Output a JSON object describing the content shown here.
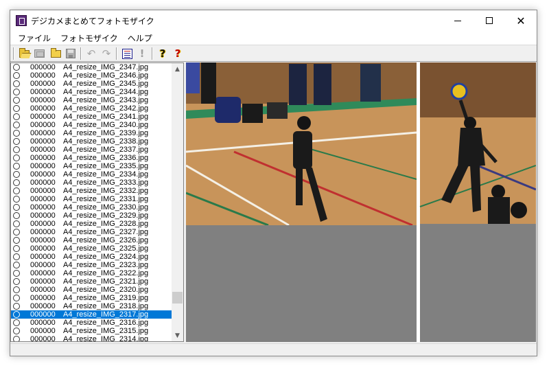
{
  "window": {
    "title": "デジカメまとめてフォトモザイク",
    "controls": {
      "minimize_icon": "minimize-icon",
      "maximize_icon": "maximize-icon",
      "close_glyph": "✕"
    }
  },
  "menu": {
    "items": [
      {
        "label": "ファイル"
      },
      {
        "label": "フォトモザイク"
      },
      {
        "label": "ヘルプ"
      }
    ]
  },
  "toolbar": {
    "icons": [
      "folder-open-icon",
      "image-gray-icon",
      "folder-icon",
      "save-icon",
      "undo-icon",
      "redo-icon",
      "list-icon",
      "exclamation-icon",
      "help-icon",
      "help-red-icon"
    ],
    "undo_glyph": "↶",
    "redo_glyph": "↷",
    "exclaim_glyph": "!",
    "help_glyph": "?",
    "help_red_glyph": "?"
  },
  "file_list": {
    "selected_index": 30,
    "rows": [
      {
        "code": "000000",
        "name": "A4_resize_IMG_2347.jpg"
      },
      {
        "code": "000000",
        "name": "A4_resize_IMG_2346.jpg"
      },
      {
        "code": "000000",
        "name": "A4_resize_IMG_2345.jpg"
      },
      {
        "code": "000000",
        "name": "A4_resize_IMG_2344.jpg"
      },
      {
        "code": "000000",
        "name": "A4_resize_IMG_2343.jpg"
      },
      {
        "code": "000000",
        "name": "A4_resize_IMG_2342.jpg"
      },
      {
        "code": "000000",
        "name": "A4_resize_IMG_2341.jpg"
      },
      {
        "code": "000000",
        "name": "A4_resize_IMG_2340.jpg"
      },
      {
        "code": "000000",
        "name": "A4_resize_IMG_2339.jpg"
      },
      {
        "code": "000000",
        "name": "A4_resize_IMG_2338.jpg"
      },
      {
        "code": "000000",
        "name": "A4_resize_IMG_2337.jpg"
      },
      {
        "code": "000000",
        "name": "A4_resize_IMG_2336.jpg"
      },
      {
        "code": "000000",
        "name": "A4_resize_IMG_2335.jpg"
      },
      {
        "code": "000000",
        "name": "A4_resize_IMG_2334.jpg"
      },
      {
        "code": "000000",
        "name": "A4_resize_IMG_2333.jpg"
      },
      {
        "code": "000000",
        "name": "A4_resize_IMG_2332.jpg"
      },
      {
        "code": "000000",
        "name": "A4_resize_IMG_2331.jpg"
      },
      {
        "code": "000000",
        "name": "A4_resize_IMG_2330.jpg"
      },
      {
        "code": "000000",
        "name": "A4_resize_IMG_2329.jpg"
      },
      {
        "code": "000000",
        "name": "A4_resize_IMG_2328.jpg"
      },
      {
        "code": "000000",
        "name": "A4_resize_IMG_2327.jpg"
      },
      {
        "code": "000000",
        "name": "A4_resize_IMG_2326.jpg"
      },
      {
        "code": "000000",
        "name": "A4_resize_IMG_2325.jpg"
      },
      {
        "code": "000000",
        "name": "A4_resize_IMG_2324.jpg"
      },
      {
        "code": "000000",
        "name": "A4_resize_IMG_2323.jpg"
      },
      {
        "code": "000000",
        "name": "A4_resize_IMG_2322.jpg"
      },
      {
        "code": "000000",
        "name": "A4_resize_IMG_2321.jpg"
      },
      {
        "code": "000000",
        "name": "A4_resize_IMG_2320.jpg"
      },
      {
        "code": "000000",
        "name": "A4_resize_IMG_2319.jpg"
      },
      {
        "code": "000000",
        "name": "A4_resize_IMG_2318.jpg"
      },
      {
        "code": "000000",
        "name": "A4_resize_IMG_2317.jpg"
      },
      {
        "code": "000000",
        "name": "A4_resize_IMG_2316.jpg"
      },
      {
        "code": "000000",
        "name": "A4_resize_IMG_2315.jpg"
      },
      {
        "code": "000000",
        "name": "A4_resize_IMG_2314.jpg"
      }
    ]
  },
  "scrollbar": {
    "up_glyph": "▲",
    "down_glyph": "▼"
  },
  "colors": {
    "selection": "#0078d7",
    "window_bg": "#f0f0f0",
    "preview_empty": "#808080",
    "gym_floor": "#c8945a",
    "gym_wall": "#7a5a3a",
    "court_green": "#2f8a5a",
    "uniform": "#1a1a1a",
    "ball_yellow": "#e8c020",
    "ball_blue": "#2040a0"
  }
}
